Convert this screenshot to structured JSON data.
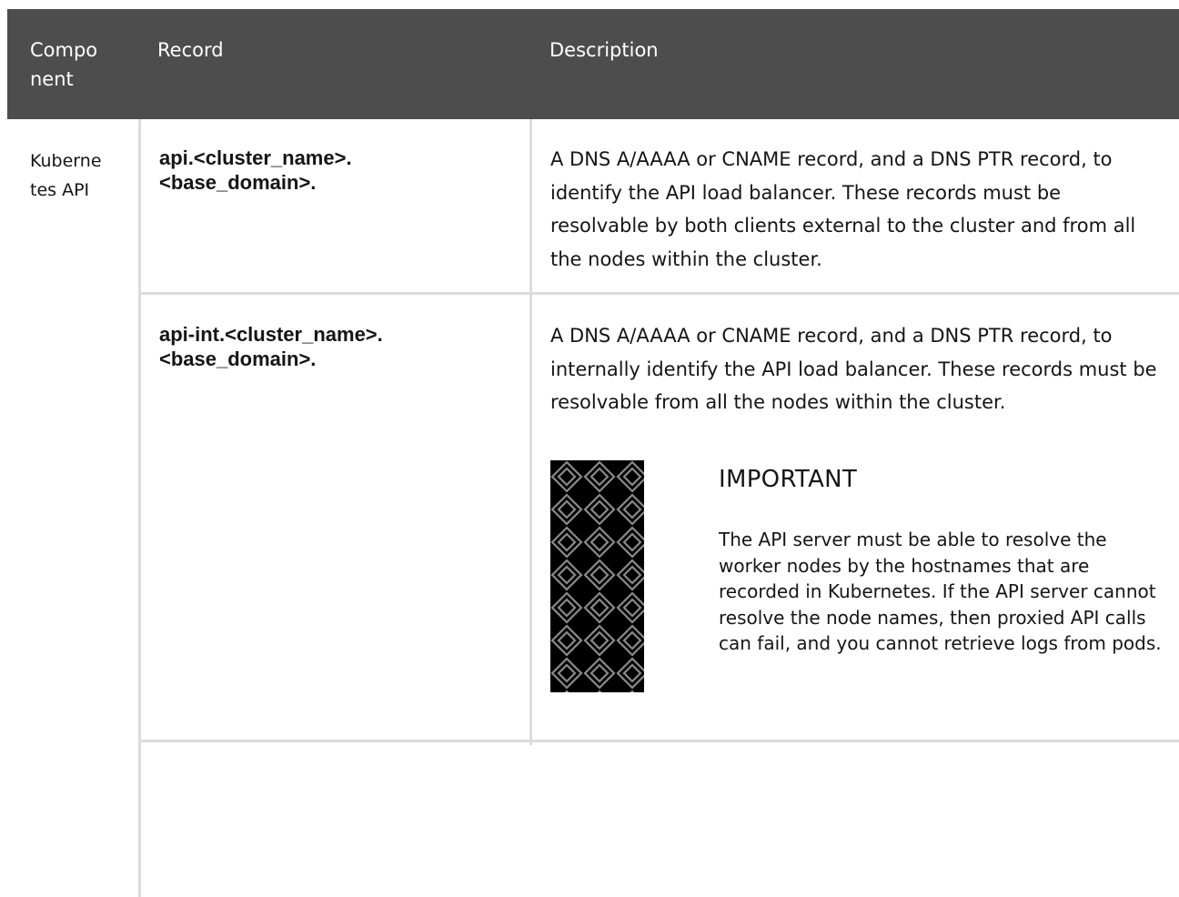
{
  "table": {
    "headers": {
      "component": "Compo nent",
      "record": "Record",
      "description": "Description"
    },
    "component_cell": "Kuberne tes API",
    "rows": [
      {
        "record_line1": "api.<cluster_name>.",
        "record_line2": "<base_domain>.",
        "description": "A DNS A/AAAA or CNAME record, and a DNS PTR record, to identify the API load balancer. These records must be resolvable by both clients external to the cluster and from all the nodes within the cluster."
      },
      {
        "record_line1": "api-int.<cluster_name>.",
        "record_line2": "<base_domain>.",
        "description": "A DNS A/AAAA or CNAME record, and a DNS PTR record, to internally identify the API load balancer. These records must be resolvable from all the nodes within the cluster.",
        "admonition": {
          "icon": "important-pattern-icon",
          "title": "IMPORTANT",
          "body": "The API server must be able to resolve the worker nodes by the hostnames that are recorded in Kubernetes. If the API server cannot resolve the node names, then proxied API calls can fail, and you cannot retrieve logs from pods."
        }
      }
    ]
  },
  "colors": {
    "header_bg": "#4d4d4d",
    "header_text": "#ffffff",
    "border": "#dcdcdc",
    "text": "#151515"
  }
}
